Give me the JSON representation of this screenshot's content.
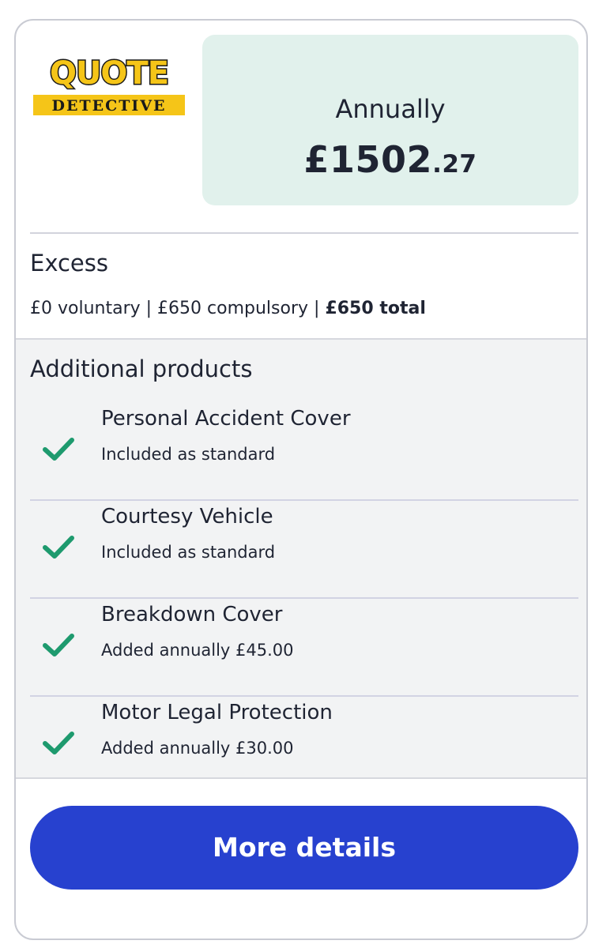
{
  "logo": {
    "line1": "QUOTE",
    "line2": "DETECTIVE"
  },
  "price": {
    "period": "Annually",
    "pounds": "£1502",
    "pence": ".27"
  },
  "excess": {
    "title": "Excess",
    "voluntary": "£0 voluntary",
    "separator": " | ",
    "compulsory": "£650 compulsory",
    "total": "£650 total"
  },
  "additional_products": {
    "title": "Additional products",
    "items": [
      {
        "name": "Personal Accident Cover",
        "status": "Included as standard",
        "icon": "check-icon"
      },
      {
        "name": "Courtesy Vehicle",
        "status": "Included as standard",
        "icon": "check-icon"
      },
      {
        "name": "Breakdown Cover",
        "status": "Added annually £45.00",
        "icon": "check-icon"
      },
      {
        "name": "Motor Legal Protection",
        "status": "Added annually £30.00",
        "icon": "check-icon"
      }
    ]
  },
  "button": {
    "label": "More details"
  },
  "colors": {
    "price_bg": "#e1f1ec",
    "check": "#1e9a6e",
    "button_bg": "#2741cf",
    "logo_yellow": "#f5c518",
    "text": "#1f2433"
  }
}
